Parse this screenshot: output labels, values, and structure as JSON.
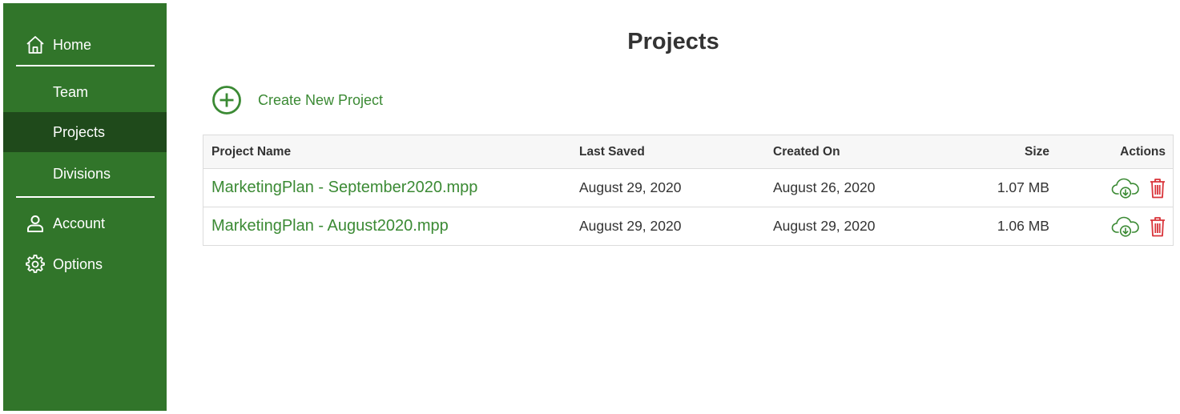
{
  "sidebar": {
    "items": [
      {
        "label": "Home",
        "icon": "home-icon"
      },
      {
        "label": "Team"
      },
      {
        "label": "Projects",
        "active": true
      },
      {
        "label": "Divisions"
      },
      {
        "label": "Account",
        "icon": "user-icon"
      },
      {
        "label": "Options",
        "icon": "gear-icon"
      }
    ]
  },
  "main": {
    "title": "Projects",
    "create_label": "Create New Project"
  },
  "table": {
    "headers": [
      "Project Name",
      "Last Saved",
      "Created On",
      "Size",
      "Actions"
    ],
    "rows": [
      {
        "name": "MarketingPlan - September2020.mpp",
        "last_saved": "August 29, 2020",
        "created_on": "August 26, 2020",
        "size": "1.07 MB"
      },
      {
        "name": "MarketingPlan - August2020.mpp",
        "last_saved": "August 29, 2020",
        "created_on": "August 29, 2020",
        "size": "1.06 MB"
      }
    ]
  },
  "colors": {
    "sidebar_bg": "#31752a",
    "sidebar_active": "#1f4a1b",
    "accent_green": "#3b8a34",
    "delete_red": "#d9343a"
  }
}
